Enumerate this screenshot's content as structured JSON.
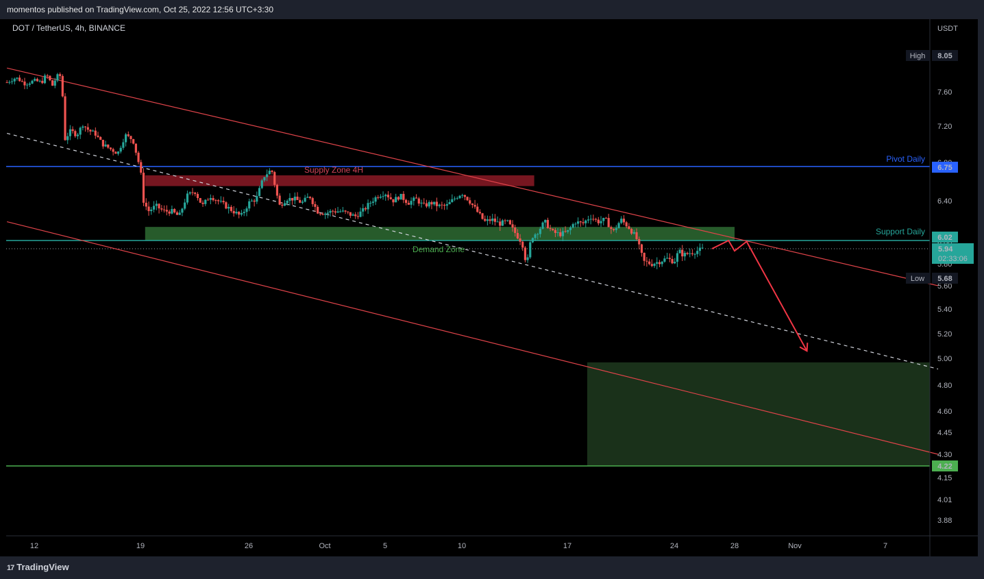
{
  "header": {
    "published": "momentos published on TradingView.com, Oct 25, 2022 12:56 UTC+3:30"
  },
  "footer": {
    "brand": "TradingView",
    "logo_glyph": "17"
  },
  "chart_data": {
    "type": "candlestick",
    "symbol": "DOT / TetherUS, 4h, BINANCE",
    "currency": "USDT",
    "ylim": [
      3.82,
      8.25
    ],
    "y_ticks": [
      "3.88",
      "4.01",
      "4.15",
      "4.30",
      "4.45",
      "4.60",
      "4.80",
      "5.00",
      "5.20",
      "5.40",
      "5.60",
      "5.80",
      "6.00",
      "6.40",
      "6.80",
      "7.20",
      "7.60",
      "8.05"
    ],
    "x_ticks": [
      {
        "label": "12",
        "t": 0
      },
      {
        "label": "19",
        "t": 7
      },
      {
        "label": "26",
        "t": 14
      },
      {
        "label": "Oct",
        "t": 19
      },
      {
        "label": "5",
        "t": 23
      },
      {
        "label": "10",
        "t": 28
      },
      {
        "label": "17",
        "t": 35
      },
      {
        "label": "24",
        "t": 42
      },
      {
        "label": "28",
        "t": 46
      },
      {
        "label": "Nov",
        "t": 50
      },
      {
        "label": "7",
        "t": 56
      }
    ],
    "price_path": [
      [
        -1.8,
        7.72
      ],
      [
        -1.2,
        7.78
      ],
      [
        -0.6,
        7.7
      ],
      [
        0,
        7.74
      ],
      [
        0.5,
        7.72
      ],
      [
        0.8,
        7.82
      ],
      [
        1.2,
        7.68
      ],
      [
        1.5,
        7.8
      ],
      [
        1.8,
        7.8
      ],
      [
        2.0,
        7.05
      ],
      [
        2.4,
        7.15
      ],
      [
        2.8,
        7.1
      ],
      [
        3.2,
        7.22
      ],
      [
        3.6,
        7.15
      ],
      [
        4.0,
        7.12
      ],
      [
        4.5,
        7.0
      ],
      [
        5.0,
        6.95
      ],
      [
        5.5,
        6.9
      ],
      [
        6.0,
        7.1
      ],
      [
        6.5,
        7.05
      ],
      [
        6.8,
        6.85
      ],
      [
        7.0,
        6.72
      ],
      [
        7.2,
        6.4
      ],
      [
        7.5,
        6.3
      ],
      [
        8.0,
        6.35
      ],
      [
        8.5,
        6.3
      ],
      [
        9.0,
        6.3
      ],
      [
        9.5,
        6.25
      ],
      [
        10.0,
        6.45
      ],
      [
        10.5,
        6.5
      ],
      [
        11.0,
        6.35
      ],
      [
        11.5,
        6.45
      ],
      [
        12.0,
        6.4
      ],
      [
        12.5,
        6.35
      ],
      [
        13.0,
        6.3
      ],
      [
        13.5,
        6.25
      ],
      [
        14.0,
        6.38
      ],
      [
        14.5,
        6.42
      ],
      [
        15.0,
        6.65
      ],
      [
        15.5,
        6.72
      ],
      [
        16.0,
        6.35
      ],
      [
        16.5,
        6.42
      ],
      [
        17.0,
        6.42
      ],
      [
        17.5,
        6.38
      ],
      [
        18.0,
        6.45
      ],
      [
        18.5,
        6.3
      ],
      [
        19.0,
        6.28
      ],
      [
        19.5,
        6.3
      ],
      [
        20.0,
        6.3
      ],
      [
        20.5,
        6.28
      ],
      [
        21.0,
        6.25
      ],
      [
        21.5,
        6.3
      ],
      [
        22.0,
        6.38
      ],
      [
        22.5,
        6.45
      ],
      [
        23.0,
        6.48
      ],
      [
        23.5,
        6.4
      ],
      [
        24.0,
        6.45
      ],
      [
        24.5,
        6.38
      ],
      [
        25.0,
        6.42
      ],
      [
        25.5,
        6.35
      ],
      [
        26.0,
        6.38
      ],
      [
        26.5,
        6.35
      ],
      [
        27.0,
        6.35
      ],
      [
        27.5,
        6.42
      ],
      [
        28.0,
        6.48
      ],
      [
        28.5,
        6.4
      ],
      [
        29.0,
        6.3
      ],
      [
        29.5,
        6.2
      ],
      [
        30.0,
        6.22
      ],
      [
        30.5,
        6.18
      ],
      [
        31.0,
        6.2
      ],
      [
        31.5,
        6.1
      ],
      [
        32.0,
        6.0
      ],
      [
        32.3,
        5.78
      ],
      [
        32.6,
        6.05
      ],
      [
        33.0,
        6.1
      ],
      [
        33.5,
        6.2
      ],
      [
        34.0,
        6.1
      ],
      [
        34.5,
        6.08
      ],
      [
        35.0,
        6.1
      ],
      [
        35.5,
        6.2
      ],
      [
        36.0,
        6.18
      ],
      [
        36.5,
        6.25
      ],
      [
        37.0,
        6.2
      ],
      [
        37.5,
        6.22
      ],
      [
        38.0,
        6.1
      ],
      [
        38.5,
        6.22
      ],
      [
        39.0,
        6.15
      ],
      [
        39.5,
        6.05
      ],
      [
        40.0,
        5.82
      ],
      [
        40.5,
        5.8
      ],
      [
        41.0,
        5.82
      ],
      [
        41.5,
        5.85
      ],
      [
        42.0,
        5.82
      ],
      [
        42.3,
        5.92
      ],
      [
        42.6,
        5.88
      ],
      [
        43.0,
        5.9
      ],
      [
        43.5,
        5.92
      ],
      [
        44.0,
        5.94
      ]
    ],
    "levels": [
      {
        "name": "High",
        "value": 8.05,
        "show_line": false
      },
      {
        "name": "Pivot Daily",
        "value": 6.75,
        "color": "#2962ff"
      },
      {
        "name": "Support Daily",
        "value": 6.02,
        "color": "#26a69a"
      },
      {
        "name": "Low",
        "value": 5.68,
        "show_line": false
      },
      {
        "name": "",
        "value": 4.22,
        "color": "#4caf50"
      }
    ],
    "current_price": {
      "value": 5.94,
      "countdown": "02:33:06"
    },
    "zones": [
      {
        "name": "Supply Zone 4H",
        "t0": 7.3,
        "t1": 32.8,
        "y0": 6.55,
        "y1": 6.66,
        "color": "#8b1a26"
      },
      {
        "name": "Demand Zone",
        "t0": 7.3,
        "t1": 46.0,
        "y0": 6.02,
        "y1": 6.15,
        "color": "#2e6b32"
      },
      {
        "name": "",
        "t0": 36.3,
        "t1": 59.5,
        "y0": 4.22,
        "y1": 4.97,
        "color": "#1e3a1e"
      }
    ],
    "trendlines": [
      {
        "style": "solid",
        "color": "#e0444a",
        "p0": [
          -1.8,
          7.9
        ],
        "p1": [
          59.5,
          5.6
        ]
      },
      {
        "style": "solid",
        "color": "#e0444a",
        "p0": [
          -1.8,
          6.2
        ],
        "p1": [
          59.5,
          4.3
        ]
      },
      {
        "style": "dashed",
        "color": "#d1d4dc",
        "p0": [
          -1.8,
          7.12
        ],
        "p1": [
          59.5,
          4.92
        ]
      }
    ],
    "projection": [
      [
        44.5,
        5.94
      ],
      [
        45.6,
        6.02
      ],
      [
        46.0,
        5.92
      ],
      [
        46.8,
        6.01
      ],
      [
        50.8,
        5.06
      ]
    ],
    "labels": {
      "high": "High",
      "high_value": "8.05",
      "low": "Low",
      "low_value": "5.68",
      "pivot": "Pivot Daily",
      "pivot_value": "6.75",
      "support": "Support Daily",
      "support_value": "6.02",
      "bottom_value": "4.22",
      "current_value": "5.94",
      "supply": "Supply Zone 4H",
      "demand": "Demand Zone"
    }
  },
  "colors": {
    "up": "#26a69a",
    "down": "#ef5350",
    "panel": "#1e222d",
    "projection": "#f23645"
  }
}
